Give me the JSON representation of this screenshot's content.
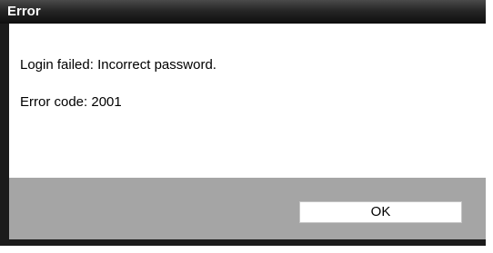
{
  "dialog": {
    "title": "Error",
    "message_lines": [
      "Login failed: Incorrect password.",
      "Error code: 2001"
    ],
    "ok_label": "OK"
  },
  "colors": {
    "titlebar": "#1b1b1b",
    "content_background": "#ffffff",
    "footer_background": "#a5a5a5",
    "button_background": "#ffffff"
  }
}
